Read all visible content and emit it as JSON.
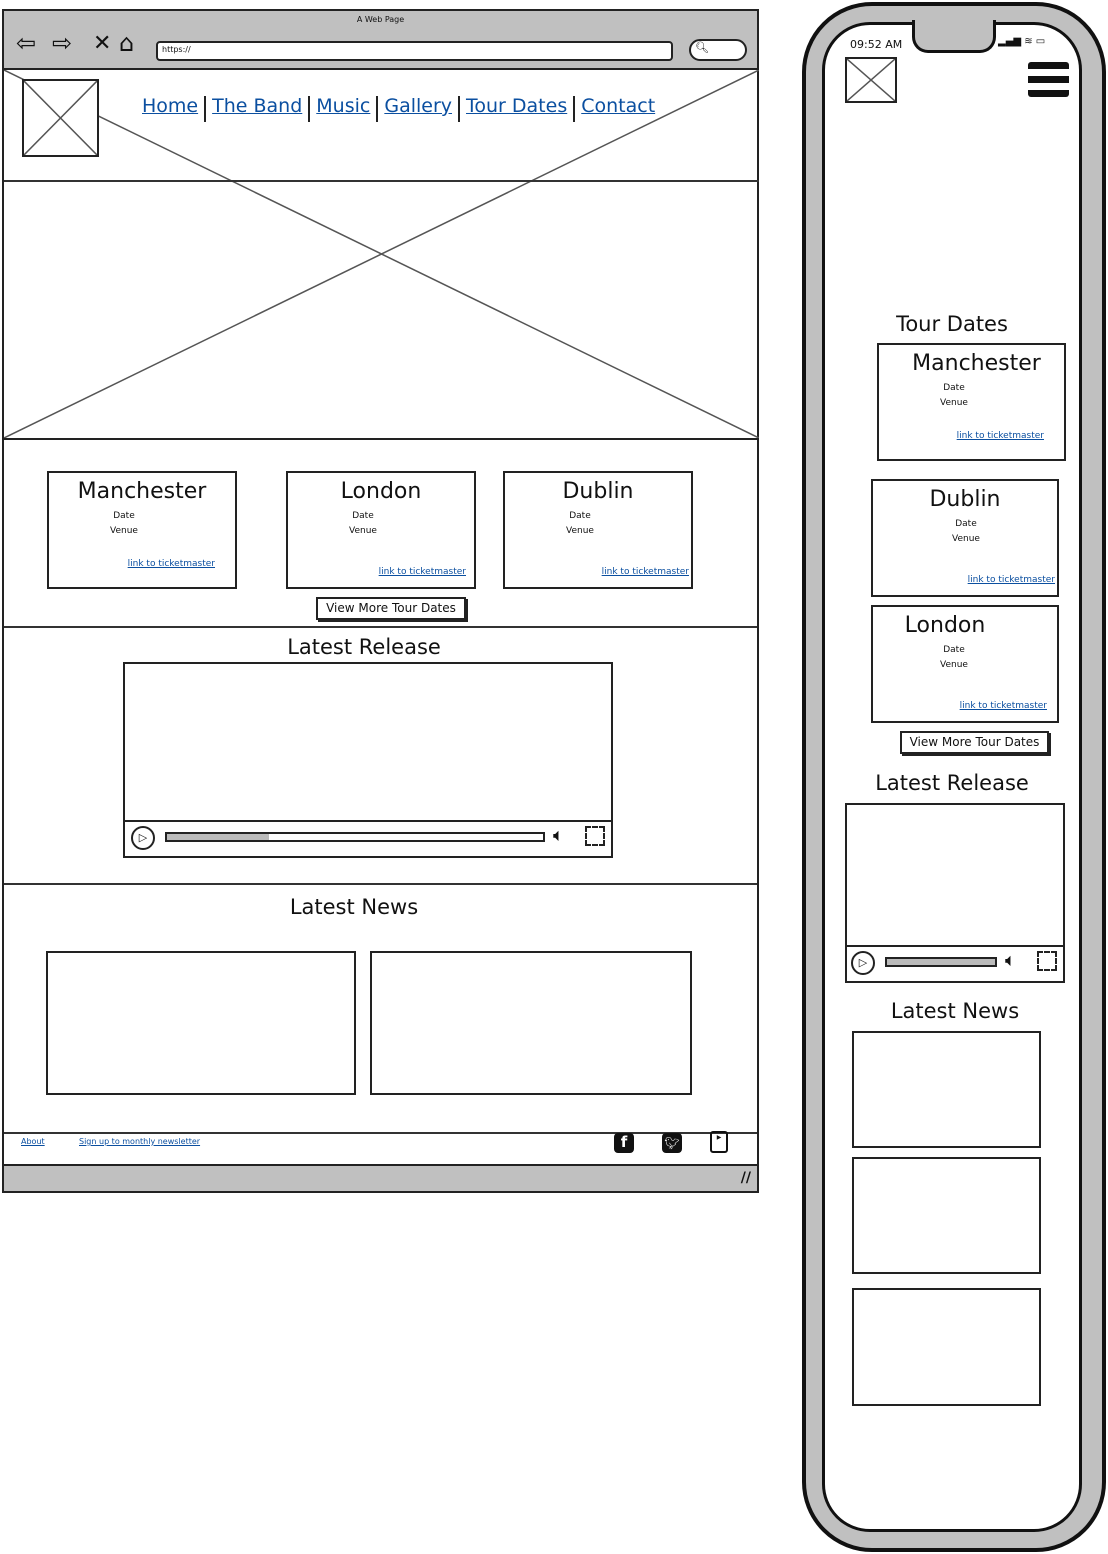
{
  "desktop": {
    "browser": {
      "title": "A Web Page",
      "url": "https://",
      "icons": [
        "back-arrow-icon",
        "forward-arrow-icon",
        "close-x-icon",
        "home-icon",
        "search-icon"
      ]
    },
    "nav": [
      "Home",
      "The Band",
      "Music",
      "Gallery",
      "Tour Dates",
      "Contact"
    ],
    "tour_cards": [
      {
        "city": "Manchester",
        "date": "Date",
        "venue": "Venue",
        "link": "link to ticketmaster"
      },
      {
        "city": "London",
        "date": "Date",
        "venue": "Venue",
        "link": "link to ticketmaster"
      },
      {
        "city": "Dublin",
        "date": "Date",
        "venue": "Venue",
        "link": "link to ticketmaster"
      }
    ],
    "more_button": "View More Tour Dates",
    "latest_release": "Latest Release",
    "latest_news": "Latest News",
    "footer": {
      "about": "About",
      "newsletter": "Sign up to monthly newsletter",
      "social": [
        "facebook-icon",
        "twitter-icon",
        "youtube-icon"
      ]
    }
  },
  "mobile": {
    "time": "09:52 AM",
    "tour_dates": "Tour Dates",
    "tour_cards": [
      {
        "city": "Manchester",
        "date": "Date",
        "venue": "Venue",
        "link": "link to ticketmaster"
      },
      {
        "city": "Dublin",
        "date": "Date",
        "venue": "Venue",
        "link": "link to ticketmaster"
      },
      {
        "city": "London",
        "date": "Date",
        "venue": "Venue",
        "link": "link to ticketmaster"
      }
    ],
    "more_button": "View More Tour Dates",
    "latest_release": "Latest Release",
    "latest_news": "Latest News"
  },
  "colors": {
    "frame_gray": "#c0c0c0",
    "link": "#0b4fa0"
  }
}
